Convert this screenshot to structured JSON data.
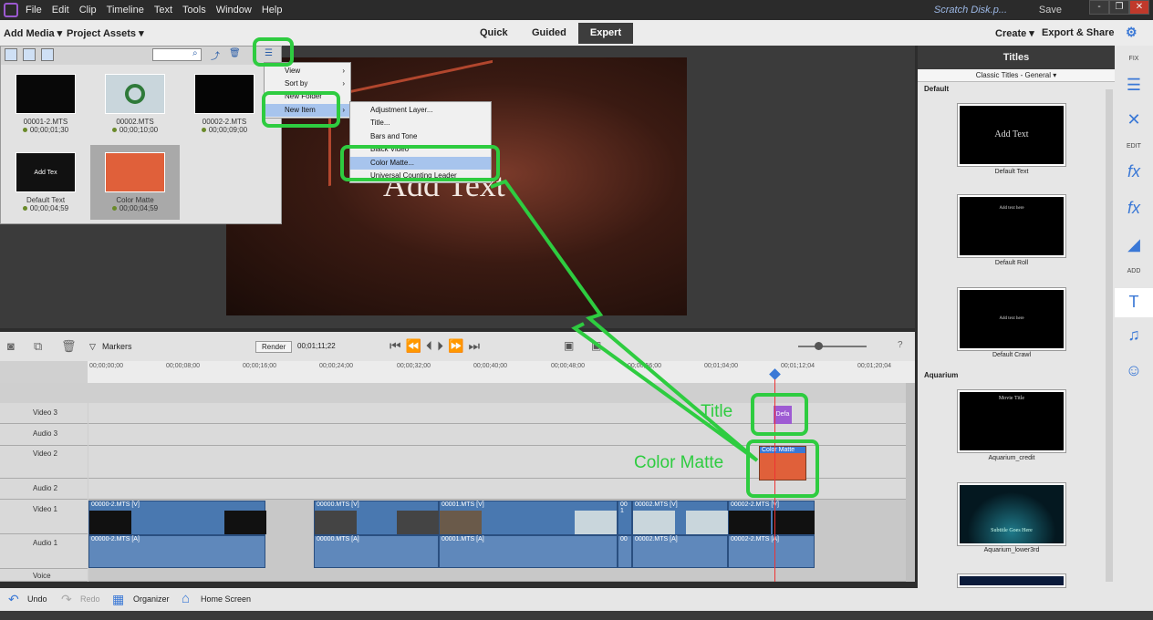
{
  "menubar": {
    "items": [
      "File",
      "Edit",
      "Clip",
      "Timeline",
      "Text",
      "Tools",
      "Window",
      "Help"
    ],
    "scratch": "Scratch Disk.p...",
    "save": "Save",
    "win_min": "-",
    "win_restore": "❐",
    "win_close": "✕"
  },
  "modebar": {
    "add_media": "Add Media ▾",
    "project_assets": "Project Assets ▾",
    "quick": "Quick",
    "guided": "Guided",
    "expert": "Expert",
    "create": "Create ▾",
    "export": "Export & Share"
  },
  "preview": {
    "overlay_text": "Add Text"
  },
  "assets": [
    {
      "name": "00001-2.MTS",
      "dur": "00;00;01;30"
    },
    {
      "name": "00002.MTS",
      "dur": "00;00;10;00"
    },
    {
      "name": "00002-2.MTS",
      "dur": "00;00;09;00"
    },
    {
      "name": "Default Text",
      "dur": "00;00;04;59",
      "thumb_text": "Add Tex"
    },
    {
      "name": "Color Matte",
      "dur": "00;00;04;59"
    }
  ],
  "menu1": {
    "items": [
      "View",
      "Sort by",
      "New Folder",
      "New Item"
    ]
  },
  "menu2": {
    "items": [
      "Adjustment Layer...",
      "Title...",
      "Bars and Tone",
      "Black Video",
      "Color Matte...",
      "Universal Counting Leader"
    ]
  },
  "titles_panel": {
    "header": "Titles",
    "dropdown": "Classic Titles - General ▾",
    "cat_default": "Default",
    "cat_aquarium": "Aquarium",
    "items": [
      {
        "caption": "Default Text",
        "text": "Add Text"
      },
      {
        "caption": "Default Roll",
        "text": "Add text here"
      },
      {
        "caption": "Default Crawl",
        "text": "Add text here"
      },
      {
        "caption": "Aquarium_credit",
        "text": "Movie Title"
      },
      {
        "caption": "Aquarium_lower3rd",
        "text": "Subtitle Goes Here"
      }
    ]
  },
  "strip": {
    "fix": "FIX",
    "edit": "EDIT",
    "add": "ADD"
  },
  "timeline": {
    "markers": "Markers",
    "render": "Render",
    "timecode": "00;01;11;22",
    "ticks": [
      "00;00;00;00",
      "00;00;08;00",
      "00;00;16;00",
      "00;00;24;00",
      "00;00;32;00",
      "00;00;40;00",
      "00;00;48;00",
      "00;00;56;00",
      "00;01;04;00",
      "00;01;12;04",
      "00;01;20;04"
    ],
    "tracks": [
      "Video 3",
      "Audio 3",
      "Video 2",
      "Audio 2",
      "Video 1",
      "Audio 1",
      "Voice"
    ],
    "title_clip": "Defa",
    "matte_clip": "Color Matte",
    "v1_clips": [
      "00000-2.MTS [V]",
      "00000.MTS [V]",
      "00001.MTS [V]",
      "00 1",
      "00002.MTS [V]",
      "00002-2.MTS [V]"
    ],
    "a1_clips": [
      "00000-2.MTS [A]",
      "00000.MTS [A]",
      "00001.MTS [A]",
      "00",
      "00002.MTS [A]",
      "00002-2.MTS [A]"
    ]
  },
  "annotations": {
    "title": "Title",
    "matte": "Color Matte"
  },
  "bottombar": {
    "undo": "Undo",
    "redo": "Redo",
    "organizer": "Organizer",
    "home": "Home Screen"
  }
}
